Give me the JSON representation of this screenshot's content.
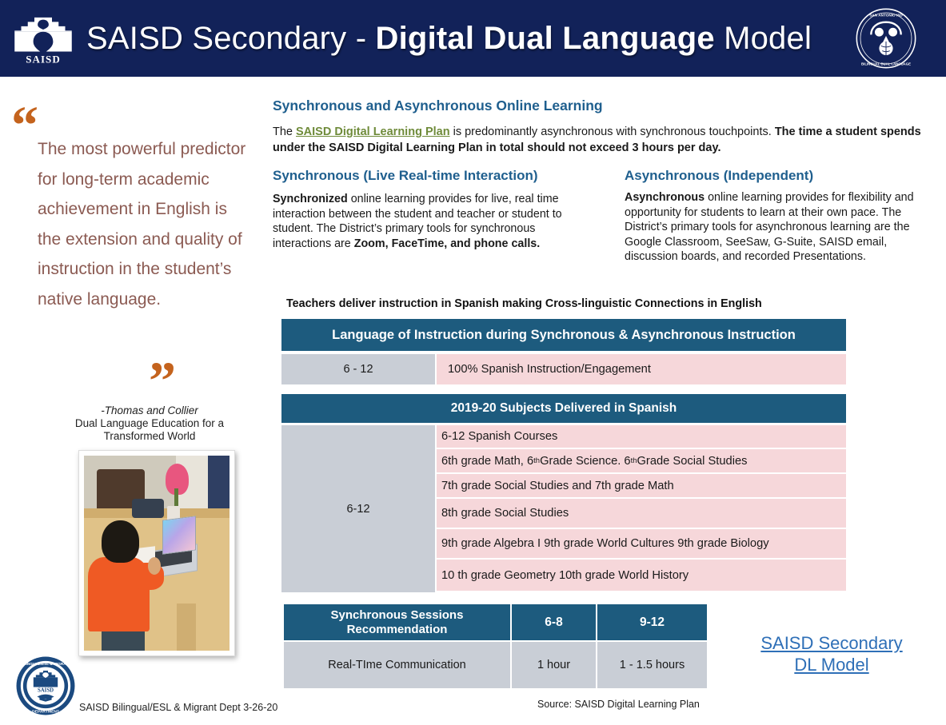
{
  "header": {
    "title_part1": "SAISD Secondary - ",
    "title_bold": "Digital Dual Language",
    "title_part2": " Model",
    "logo_text": "SAISD",
    "seal_top_text": "SAN ANTONIO ISD",
    "seal_bottom_text": "BILINGUAL DUAL LANGUAGE",
    "bg_color": "#122259"
  },
  "quote": {
    "open_mark": "“",
    "close_mark": "”",
    "text": "The most powerful predictor for long-term academic achievement in English is the extension and quality of instruction in the student’s native language.",
    "attribution": "-Thomas and Collier",
    "source_line1": "Dual Language Education for a",
    "source_line2": "Transformed World",
    "text_color": "#8b5a52",
    "mark_color": "#c4631d"
  },
  "photo": {
    "alt": "Student working on a laptop at a dining table"
  },
  "dept_seal": {
    "top_text": "BILINGUAL/ESL & MIGRANT",
    "bottom_text": "DEPARTMENT",
    "center_text": "SAISD"
  },
  "footer": {
    "note": "SAISD Bilingual/ESL & Migrant Dept   3-26-20",
    "source": "Source: SAISD Digital Learning Plan"
  },
  "main": {
    "section_title": "Synchronous and Asynchronous Online Learning",
    "intro": {
      "pre_link": "The ",
      "link_text": "SAISD Digital Learning Plan",
      "post_link": " is predominantly asynchronous with synchronous touchpoints. ",
      "bold_tail": "The time a student spends under the SAISD Digital Learning Plan in total should not exceed 3 hours per day."
    },
    "sync": {
      "heading": "Synchronous (Live Real-time Interaction)",
      "lead": "Synchronized",
      "body": " online learning provides for live, real time interaction between the student and teacher or student to student. The District’s primary tools for synchronous interactions are ",
      "bold_tail": "Zoom, FaceTime, and phone calls."
    },
    "async": {
      "heading": "Asynchronous (Independent)",
      "lead": "Asynchronous",
      "body": " online learning provides for flexibility and opportunity for students to learn at their own pace. The District’s primary tools for asynchronous learning are the Google Classroom, SeeSaw, G-Suite, SAISD email, discussion boards, and recorded Presentations."
    }
  },
  "tables": {
    "caption": "Teachers deliver instruction in Spanish making Cross-linguistic Connections in English",
    "language_table": {
      "header": "Language of Instruction during Synchronous & Asynchronous Instruction",
      "grade": "6 - 12",
      "description": "100% Spanish Instruction/Engagement"
    },
    "subjects_table": {
      "header": "2019-20 Subjects Delivered in Spanish",
      "grade": "6-12",
      "rows": [
        "6-12  Spanish Courses",
        "6th grade Math, 6th Grade Science.  6th Grade Social Studies",
        "7th grade Social Studies and 7th grade Math",
        "8th grade Social Studies",
        "9th grade Algebra I   9th grade World Cultures   9th grade Biology",
        "10 th grade Geometry  10th grade World History"
      ]
    },
    "sessions_table": {
      "header_label": "Synchronous Sessions Recommendation",
      "header_col1": "6-8",
      "header_col2": "9-12",
      "row_label": "Real-TIme Communication",
      "row_col1": "1 hour",
      "row_col2": "1 - 1.5 hours"
    },
    "header_color": "#1d5b7e",
    "gray_color": "#c9ced6",
    "pink_color": "#f6d7da"
  },
  "dl_link": {
    "line1": "SAISD Secondary",
    "line2": "DL Model",
    "color": "#2e6fb7"
  }
}
